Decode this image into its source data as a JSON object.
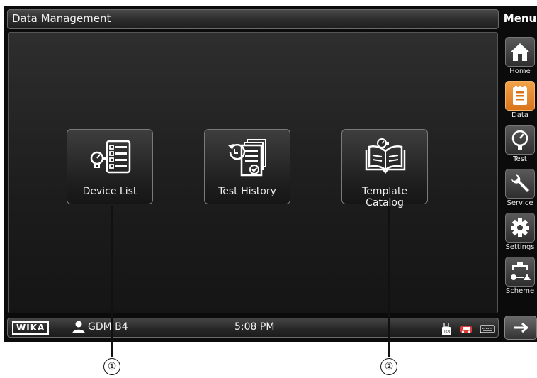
{
  "header": {
    "title": "Data Management",
    "menu_label": "Menu"
  },
  "tiles": [
    {
      "label": "Device List",
      "icon": "device-list-icon"
    },
    {
      "label": "Test History",
      "icon": "test-history-icon"
    },
    {
      "label": "Template Catalog",
      "icon": "template-catalog-icon"
    }
  ],
  "sidebar": {
    "items": [
      {
        "label": "Home",
        "icon": "home-icon",
        "active": false
      },
      {
        "label": "Data",
        "icon": "data-icon",
        "active": true
      },
      {
        "label": "Test",
        "icon": "gauge-icon",
        "active": false
      },
      {
        "label": "Service",
        "icon": "wrench-icon",
        "active": false
      },
      {
        "label": "Settings",
        "icon": "gear-icon",
        "active": false
      },
      {
        "label": "Scheme",
        "icon": "scheme-icon",
        "active": false
      }
    ],
    "next_icon": "arrow-right-icon"
  },
  "status_bar": {
    "brand": "WIKA",
    "user": "GDM B4",
    "time": "5:08 PM",
    "icons": [
      "usb-icon",
      "car-icon",
      "keyboard-icon"
    ]
  },
  "callouts": [
    "①",
    "②"
  ],
  "colors": {
    "active_accent": "#e8862e",
    "screen_bg": "#1c1c1c"
  }
}
